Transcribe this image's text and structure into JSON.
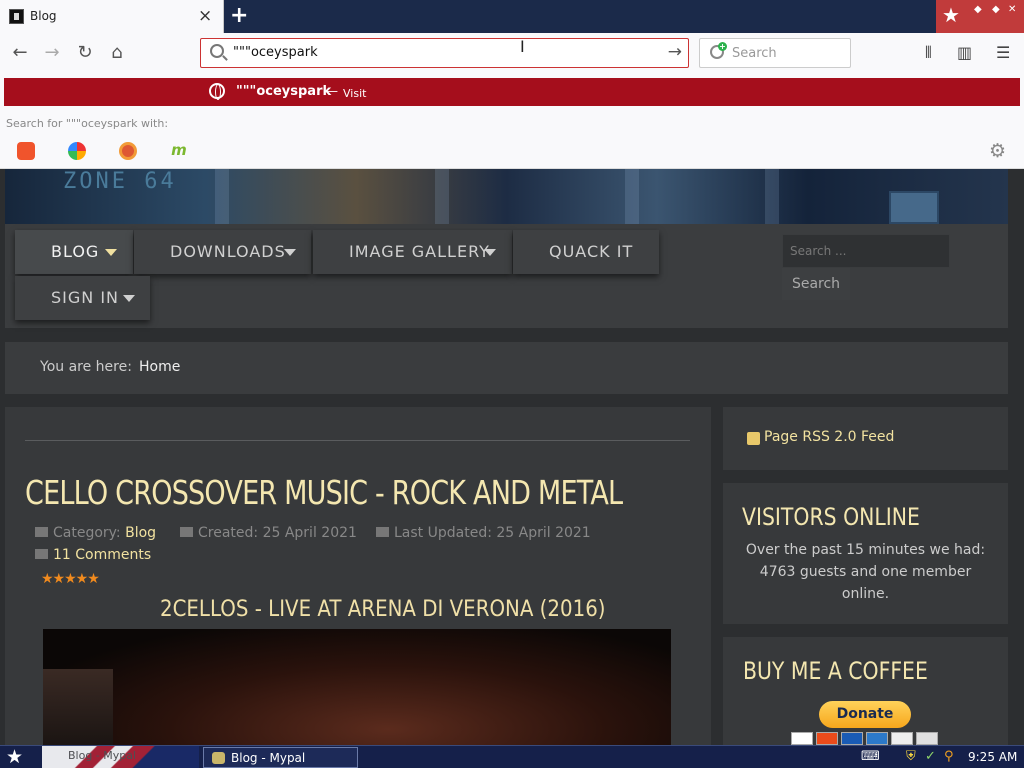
{
  "browser": {
    "tab_title": "Blog",
    "close_glyph": "×",
    "new_tab_glyph": "+",
    "url_value": "\"\"\"oceyspark",
    "search_placeholder": "Search"
  },
  "dropdown": {
    "suggestion_text": "\"\"\"oceyspark",
    "suggestion_dash": "—",
    "suggestion_action": "Visit",
    "search_with_label": "Search for \"\"\"oceyspark with:",
    "engines": [
      "brave-icon",
      "qwant-icon",
      "duckduckgo-icon",
      "mojeek-icon"
    ]
  },
  "site": {
    "menu": [
      {
        "label": "BLOG",
        "caret": true
      },
      {
        "label": "DOWNLOADS",
        "caret": true
      },
      {
        "label": "IMAGE GALLERY",
        "caret": true
      },
      {
        "label": "QUACK IT",
        "caret": false
      },
      {
        "label": "SIGN IN",
        "caret": true
      }
    ],
    "search_placeholder": "Search ...",
    "search_button": "Search",
    "breadcrumb": {
      "label": "You are here:",
      "current": "Home"
    }
  },
  "article": {
    "title": "CELLO CROSSOVER MUSIC - ROCK AND METAL",
    "category_label": "Category:",
    "category_value": "Blog",
    "created": "Created: 25 April 2021",
    "updated": "Last Updated: 25 April 2021",
    "comments": "11 Comments",
    "rating_stars": "★★★★★",
    "subtitle": "2CELLOS - LIVE AT ARENA DI VERONA (2016)"
  },
  "sidebar": {
    "rss_label": "Page RSS 2.0 Feed",
    "visitors_title": "VISITORS ONLINE",
    "visitors_text": "Over the past 15 minutes we had: 4763 guests and one member online.",
    "coffee_title": "BUY ME A COFFEE",
    "donate_label": "Donate"
  },
  "taskbar": {
    "flag_task": "Blog - Mypal",
    "active_task": "Blog - Mypal",
    "clock": "9:25 AM"
  },
  "colors": {
    "accent_red": "#a50e1c",
    "heading_gold": "#f4e7b0",
    "star_orange": "#f08a1e",
    "page_bg": "#2c2e30"
  }
}
